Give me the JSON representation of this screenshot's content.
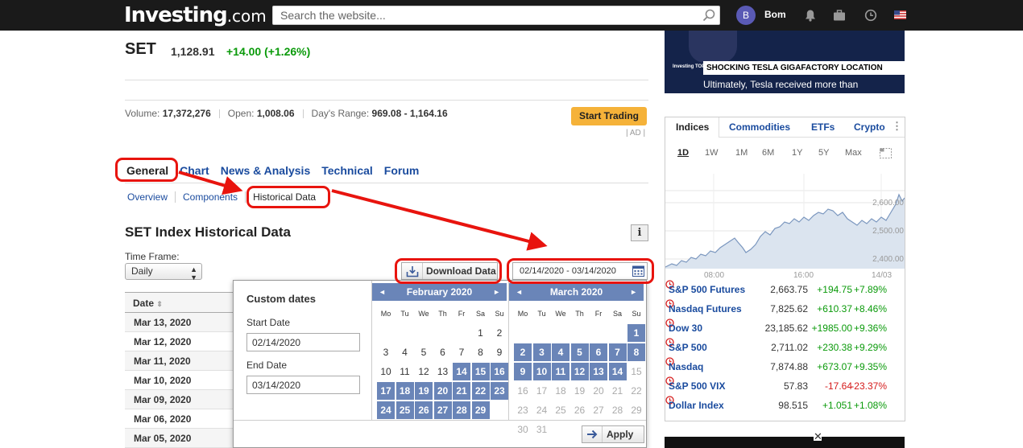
{
  "header": {
    "logo_main": "Investing",
    "logo_suffix": ".com",
    "search_placeholder": "Search the website...",
    "avatar_letter": "B",
    "username": "Bom"
  },
  "instrument": {
    "name": "SET",
    "last": "1,128.91",
    "change": "+14.00 (+1.26%)",
    "volume_label": "Volume:",
    "volume": "17,372,276",
    "open_label": "Open:",
    "open": "1,008.06",
    "range_label": "Day's Range:",
    "range": "969.08 - 1,164.16",
    "start_trading": "Start Trading",
    "ad": "| AD |"
  },
  "tabs": [
    "General",
    "Chart",
    "News & Analysis",
    "Technical",
    "Forum"
  ],
  "subtabs": [
    "Overview",
    "Components",
    "Historical Data"
  ],
  "historical": {
    "title": "SET Index Historical Data",
    "info": "i",
    "timeframe_label": "Time Frame:",
    "timeframe": "Daily",
    "download": "Download Data",
    "date_range": "02/14/2020 - 03/14/2020",
    "date_col": "Date",
    "rows": [
      "Mar 13, 2020",
      "Mar 12, 2020",
      "Mar 11, 2020",
      "Mar 10, 2020",
      "Mar 09, 2020",
      "Mar 06, 2020",
      "Mar 05, 2020"
    ]
  },
  "popup": {
    "title": "Custom dates",
    "start_label": "Start Date",
    "start_value": "02/14/2020",
    "end_label": "End Date",
    "end_value": "03/14/2020",
    "apply": "Apply",
    "weekdays": [
      "Mo",
      "Tu",
      "We",
      "Th",
      "Fr",
      "Sa",
      "Su"
    ],
    "feb_title": "February 2020",
    "mar_title": "March 2020"
  },
  "video": {
    "headline": "SHOCKING TESLA GIGAFACTORY LOCATION",
    "sub": "Ultimately, Tesla received more than",
    "brand": "Investing TOP STORIES"
  },
  "widget": {
    "tabs": [
      "Indices",
      "Commodities",
      "ETFs",
      "Crypto"
    ],
    "periods": [
      "1D",
      "1W",
      "1M",
      "6M",
      "1Y",
      "5Y",
      "Max"
    ],
    "chart_y_ticks": [
      "2,600.00",
      "2,500.00",
      "2,400.00"
    ],
    "chart_x_ticks": [
      "08:00",
      "16:00",
      "14/03"
    ],
    "rows": [
      {
        "name": "S&P 500 Futures",
        "last": "2,663.75",
        "chg": "+194.75",
        "pct": "+7.89%",
        "dir": "up"
      },
      {
        "name": "Nasdaq Futures",
        "last": "7,825.62",
        "chg": "+610.37",
        "pct": "+8.46%",
        "dir": "up"
      },
      {
        "name": "Dow 30",
        "last": "23,185.62",
        "chg": "+1985.00",
        "pct": "+9.36%",
        "dir": "up"
      },
      {
        "name": "S&P 500",
        "last": "2,711.02",
        "chg": "+230.38",
        "pct": "+9.29%",
        "dir": "up"
      },
      {
        "name": "Nasdaq",
        "last": "7,874.88",
        "chg": "+673.07",
        "pct": "+9.35%",
        "dir": "up"
      },
      {
        "name": "S&P 500 VIX",
        "last": "57.83",
        "chg": "-17.64",
        "pct": "-23.37%",
        "dir": "down"
      },
      {
        "name": "Dollar Index",
        "last": "98.515",
        "chg": "+1.051",
        "pct": "+1.08%",
        "dir": "up"
      }
    ]
  },
  "colors": {
    "accent": "#1a4b9e",
    "up": "#0a9a0a",
    "down": "#d51a1a",
    "highlight": "#e8140e",
    "calendar_selected": "#6a85b8"
  }
}
